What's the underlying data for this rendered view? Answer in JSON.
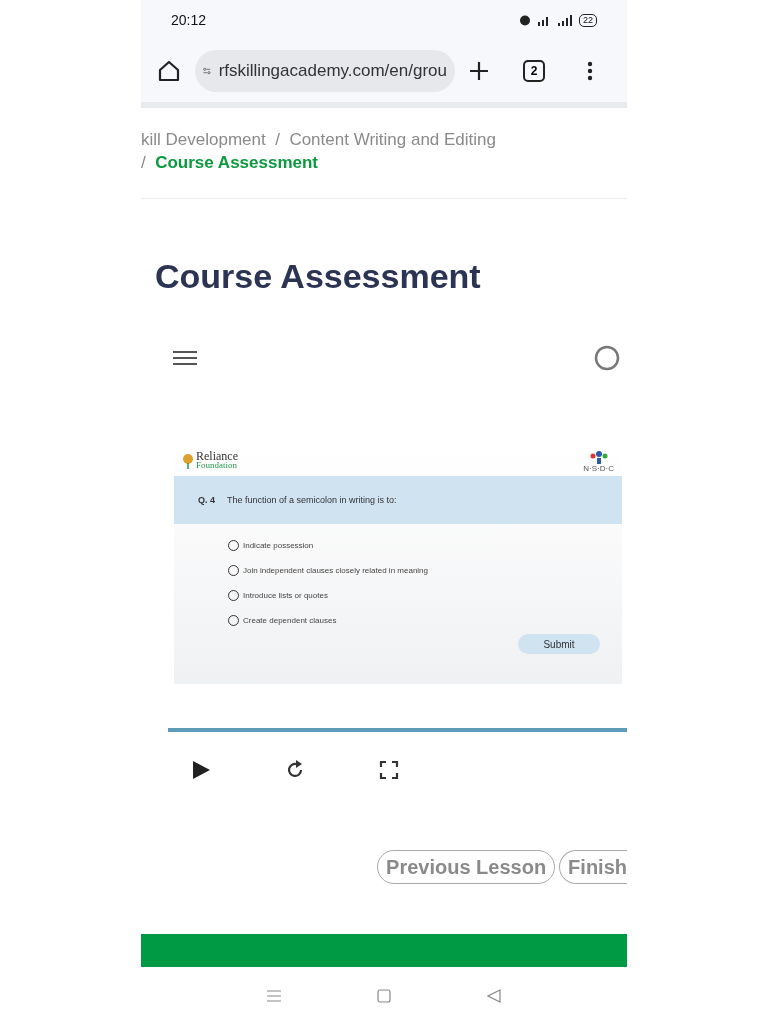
{
  "status_bar": {
    "time": "20:12",
    "battery": "22"
  },
  "browser": {
    "url": "rfskillingacademy.com/en/grou",
    "tab_count": "2"
  },
  "breadcrumb": {
    "items": [
      "kill Development",
      "Content Writing and Editing"
    ],
    "current": "Course Assessment",
    "separators": [
      "/",
      "/"
    ]
  },
  "title": "Course Assessment",
  "slide": {
    "logo_left": {
      "line1": "Reliance",
      "line2": "Foundation"
    },
    "logo_right": "N·S·D·C",
    "question_number": "Q. 4",
    "question": "The function of a semicolon in writing is to:",
    "options": [
      {
        "label": "Indicate possession",
        "selected": false
      },
      {
        "label": "Join independent clauses closely related in meaning",
        "selected": false
      },
      {
        "label": "Introduce lists or quotes",
        "selected": false
      },
      {
        "label": "Create dependent clauses",
        "selected": false
      }
    ],
    "submit": "Submit"
  },
  "player": {
    "progress": {
      "level": 1
    }
  },
  "nav_buttons": [
    "Previous Lesson",
    "Finish"
  ]
}
